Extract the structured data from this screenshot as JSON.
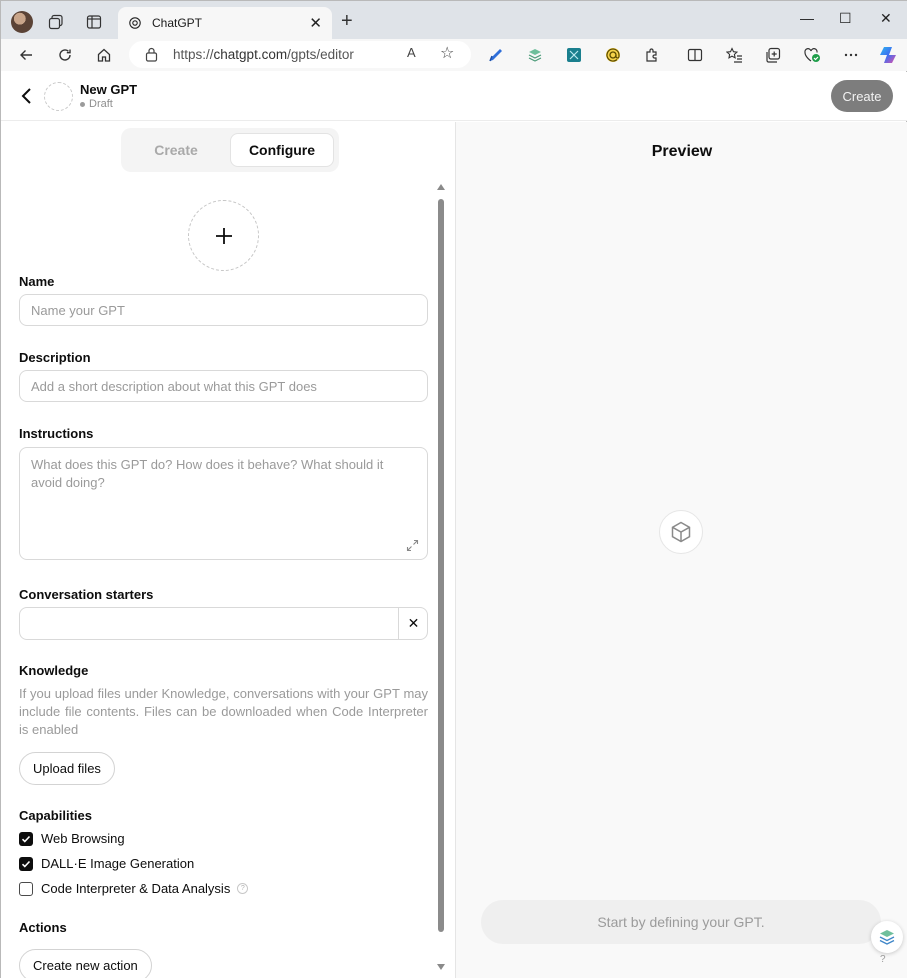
{
  "browser": {
    "tab_title": "ChatGPT",
    "tab_close": "✕",
    "new_tab": "+",
    "url_prefix": "https://",
    "url_host": "chatgpt.com",
    "url_path": "/gpts/editor",
    "read_aloud": "A",
    "window_controls": {
      "minimize": "—",
      "maximize": "☐",
      "close": "✕"
    }
  },
  "header": {
    "gpt_name": "New GPT",
    "status": "Draft",
    "create_button": "Create"
  },
  "editor": {
    "tabs": {
      "create": "Create",
      "configure": "Configure"
    },
    "name": {
      "label": "Name",
      "placeholder": "Name your GPT"
    },
    "description": {
      "label": "Description",
      "placeholder": "Add a short description about what this GPT does"
    },
    "instructions": {
      "label": "Instructions",
      "placeholder": "What does this GPT do? How does it behave? What should it avoid doing?"
    },
    "starters": {
      "label": "Conversation starters",
      "clear": "✕"
    },
    "knowledge": {
      "label": "Knowledge",
      "help": "If you upload files under Knowledge, conversations with your GPT may include file contents. Files can be downloaded when Code Interpreter is enabled",
      "upload_button": "Upload files"
    },
    "capabilities": {
      "label": "Capabilities",
      "items": [
        {
          "label": "Web Browsing",
          "checked": true
        },
        {
          "label": "DALL·E Image Generation",
          "checked": true
        },
        {
          "label": "Code Interpreter & Data Analysis",
          "checked": false
        }
      ],
      "info": "?"
    },
    "actions": {
      "label": "Actions",
      "create_button": "Create new action"
    }
  },
  "preview": {
    "title": "Preview",
    "input_placeholder": "Start by defining your GPT.",
    "help": "?"
  },
  "colors": {
    "tabbar": "#dfe3e8",
    "create_button_bg": "#7d7d7d",
    "preview_bg": "#f9f9f9"
  }
}
